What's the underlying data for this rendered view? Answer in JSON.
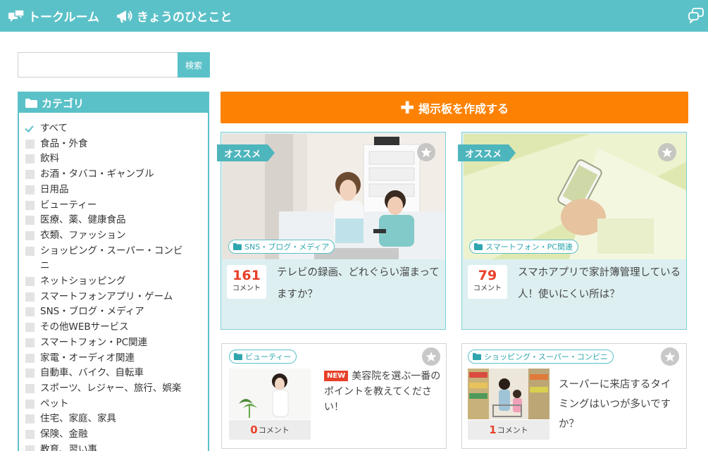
{
  "header": {
    "nav": [
      {
        "label": "トークルーム",
        "icon": "chat-bubbles-icon"
      },
      {
        "label": "きょうのひとこと",
        "icon": "megaphone-icon"
      }
    ],
    "right_icon": "speech-bubbles-icon"
  },
  "search": {
    "placeholder": "",
    "button_label": "検索"
  },
  "sidebar": {
    "title": "カテゴリ",
    "categories": [
      {
        "label": "すべて",
        "checked": true
      },
      {
        "label": "食品・外食",
        "checked": false
      },
      {
        "label": "飲料",
        "checked": false
      },
      {
        "label": "お酒・タバコ・ギャンブル",
        "checked": false
      },
      {
        "label": "日用品",
        "checked": false
      },
      {
        "label": "ビューティー",
        "checked": false
      },
      {
        "label": "医療、薬、健康食品",
        "checked": false
      },
      {
        "label": "衣類、ファッション",
        "checked": false
      },
      {
        "label": "ショッピング・スーパー・コンビニ",
        "checked": false
      },
      {
        "label": "ネットショッピング",
        "checked": false
      },
      {
        "label": "スマートフォンアプリ・ゲーム",
        "checked": false
      },
      {
        "label": "SNS・ブログ・メディア",
        "checked": false
      },
      {
        "label": "その他WEBサービス",
        "checked": false
      },
      {
        "label": "スマートフォン・PC関連",
        "checked": false
      },
      {
        "label": "家電・オーディオ関連",
        "checked": false
      },
      {
        "label": "自動車、バイク、自転車",
        "checked": false
      },
      {
        "label": "スポーツ、レジャー、旅行、娯楽",
        "checked": false
      },
      {
        "label": "ペット",
        "checked": false
      },
      {
        "label": "住宅、家庭、家具",
        "checked": false
      },
      {
        "label": "保険、金融",
        "checked": false
      },
      {
        "label": "教育、習い事",
        "checked": false
      }
    ]
  },
  "create_button": {
    "label": "掲示板を作成する"
  },
  "featured": [
    {
      "ribbon": "オススメ",
      "category": "SNS・ブログ・メディア",
      "count": "161",
      "count_label": "コメント",
      "title": "テレビの録画、どれぐらい溜まってますか？"
    },
    {
      "ribbon": "オススメ",
      "category": "スマートフォン・PC関連",
      "count": "79",
      "count_label": "コメント",
      "title": "スマホアプリで家計簿管理している人！使いにくい所は？"
    }
  ],
  "posts": [
    {
      "category": "ビューティー",
      "badge": "NEW",
      "title": "美容院を選ぶ一番のポイントを教えてください！",
      "count": "0",
      "count_label": "コメント"
    },
    {
      "category": "ショッピング・スーパー・コンビニ",
      "badge": "",
      "title": "スーパーに来店するタイミングはいつが多いですか？",
      "count": "1",
      "count_label": "コメント"
    }
  ],
  "colors": {
    "teal": "#5bc1c8",
    "orange": "#fd8204",
    "count_red": "#e8412a",
    "featured_bg": "#ddeff1"
  }
}
